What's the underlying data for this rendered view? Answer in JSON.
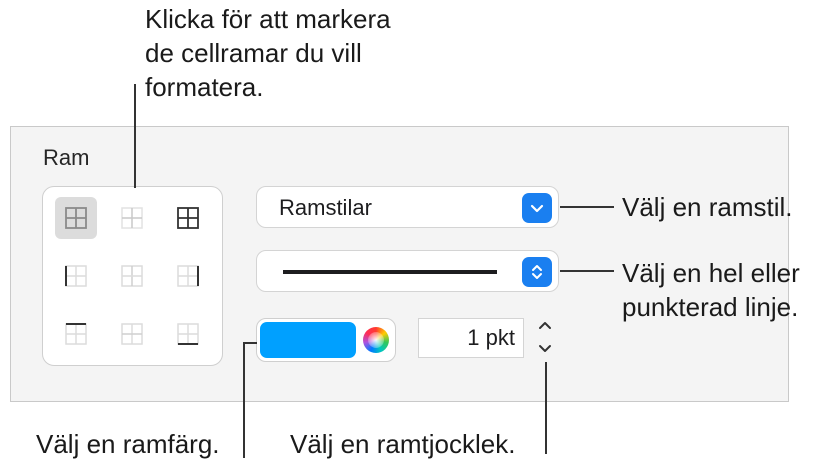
{
  "callouts": {
    "top": [
      "Klicka för att markera",
      "de cellramar du vill",
      "formatera."
    ],
    "border_style": "Välj en ramstil.",
    "line_type": [
      "Välj en hel eller",
      "punkterad linje."
    ],
    "border_color": "Välj en ramfärg.",
    "border_thickness": "Välj en ramtjocklek."
  },
  "panel": {
    "section_title": "Ram",
    "border_style_dropdown": "Ramstilar",
    "line_style": "solid",
    "color": "#00a0ff",
    "thickness_value": "1 pkt"
  },
  "colors": {
    "accent": "#1a7ff0",
    "panel_bg": "#f4f4f4"
  },
  "icons": {
    "border_grid": [
      "all-borders-icon",
      "inside-borders-icon",
      "outer-borders-icon",
      "left-border-icon",
      "inside-vertical-icon",
      "right-border-icon",
      "top-border-icon",
      "inside-horizontal-icon",
      "bottom-border-icon"
    ],
    "dropdown_button": "chevron-down-icon",
    "line_button": "up-down-chevron-icon",
    "color_wheel": "color-wheel-icon",
    "stepper": "stepper-icon"
  }
}
